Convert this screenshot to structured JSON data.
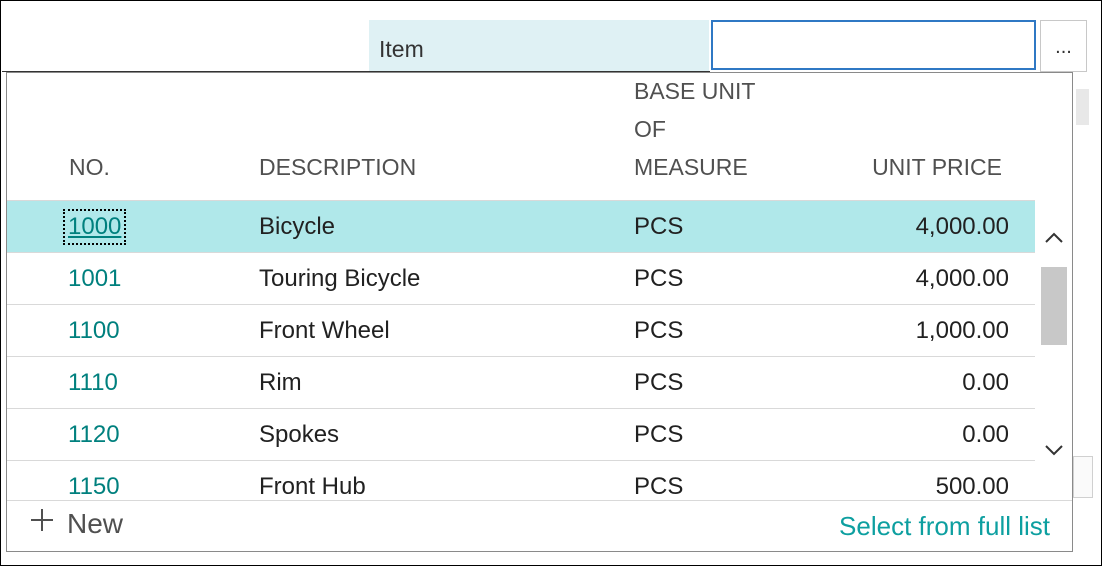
{
  "field": {
    "caption": "Item",
    "value": "",
    "lookup_label": "..."
  },
  "lookup": {
    "columns": {
      "no": "NO.",
      "description": "DESCRIPTION",
      "base_unit_of_measure": "BASE UNIT OF MEASURE",
      "unit_price": "UNIT PRICE"
    },
    "rows": [
      {
        "no": "1000",
        "description": "Bicycle",
        "uom": "PCS",
        "price": "4,000.00",
        "selected": true
      },
      {
        "no": "1001",
        "description": "Touring Bicycle",
        "uom": "PCS",
        "price": "4,000.00"
      },
      {
        "no": "1100",
        "description": "Front Wheel",
        "uom": "PCS",
        "price": "1,000.00"
      },
      {
        "no": "1110",
        "description": "Rim",
        "uom": "PCS",
        "price": "0.00"
      },
      {
        "no": "1120",
        "description": "Spokes",
        "uom": "PCS",
        "price": "0.00"
      },
      {
        "no": "1150",
        "description": "Front Hub",
        "uom": "PCS",
        "price": "500.00"
      }
    ],
    "footer": {
      "new_label": "New",
      "new_icon": "plus-icon",
      "select_full_list": "Select from full list"
    },
    "scroll": {
      "up_icon": "chevron-up-icon",
      "down_icon": "chevron-down-icon"
    }
  },
  "colors": {
    "selected_row": "#b0e8ea",
    "link": "#00807e",
    "accent": "#0d9fa0",
    "caption_bg": "#dff1f4"
  }
}
